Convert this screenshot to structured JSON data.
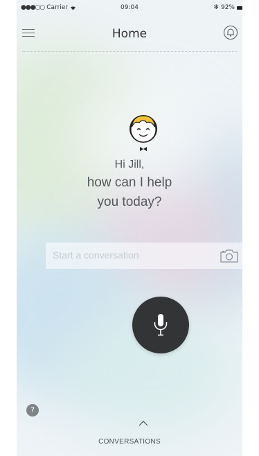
{
  "status_bar": {
    "carrier": "Carrier",
    "signal_dots": "●●●○○",
    "time": "09:04",
    "bluetooth": "✻",
    "battery": "92%"
  },
  "nav": {
    "title": "Home",
    "menu_icon": "hamburger-menu-icon",
    "right_icon": "bell-icon"
  },
  "assistant": {
    "avatar_icon": "smiling-boy-avatar",
    "greeting_line1": "Hi Jill,",
    "greeting_line2": "how can I help",
    "greeting_line3": "you today?"
  },
  "conversation_input": {
    "placeholder": "Start a conversation",
    "camera_icon": "camera-icon"
  },
  "mic": {
    "icon": "microphone-icon",
    "background": "#333435"
  },
  "footer": {
    "help_label": "?",
    "expand_icon": "chevron-up-icon",
    "conversations_label": "CONVERSATIONS"
  }
}
